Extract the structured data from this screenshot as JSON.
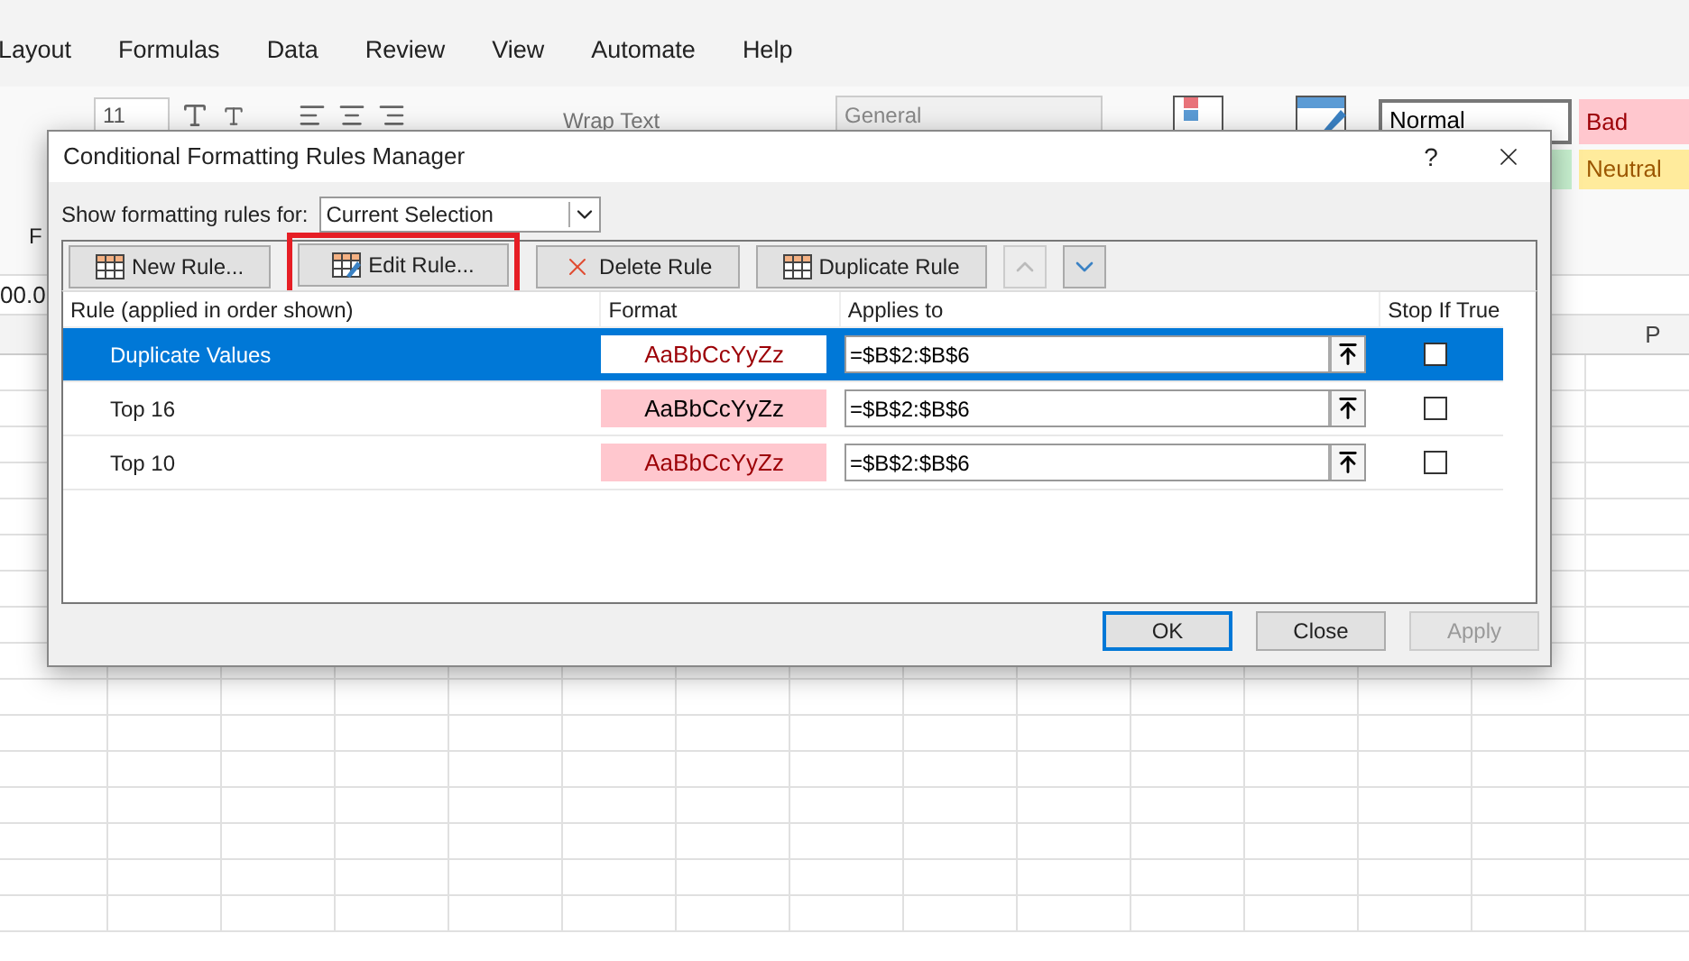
{
  "menu": [
    "Layout",
    "Formulas",
    "Data",
    "Review",
    "View",
    "Automate",
    "Help"
  ],
  "ribbon": {
    "font_size": "11",
    "wrap_text": "Wrap Text",
    "number_format": "General",
    "left_cut_1": "F",
    "left_cut_2": "00.0",
    "styles": [
      {
        "label": "Normal",
        "kind": "normal",
        "color": "#ffffff"
      },
      {
        "label": "Bad",
        "kind": "bad",
        "color": "#ffc7ce"
      },
      {
        "label": "Neutral",
        "kind": "neutral",
        "color": "#ffeb9c"
      }
    ]
  },
  "sheet": {
    "column_header": "P"
  },
  "dialog": {
    "title": "Conditional Formatting Rules Manager",
    "help": "?",
    "filter_label": "Show formatting rules for:",
    "filter_value": "Current Selection",
    "toolbar": [
      {
        "kind": "new",
        "label": "New Rule...",
        "disabled": false,
        "highlighted": false
      },
      {
        "kind": "edit",
        "label": "Edit Rule...",
        "disabled": false,
        "highlighted": true
      },
      {
        "kind": "delete",
        "label": "Delete Rule",
        "disabled": false,
        "highlighted": false
      },
      {
        "kind": "duplicate",
        "label": "Duplicate Rule",
        "disabled": false,
        "highlighted": false
      },
      {
        "kind": "up",
        "disabled": true,
        "highlighted": false
      },
      {
        "kind": "down",
        "disabled": false,
        "highlighted": false
      }
    ],
    "columns": [
      "Rule (applied in order shown)",
      "Format",
      "Applies to",
      "Stop If True"
    ],
    "rules": [
      {
        "name": "Duplicate Values",
        "sample": "AaBbCcYyZz",
        "kind": "plain",
        "color": "#9c0006",
        "applies_to": "=$B$2:$B$6",
        "stop_if_true": false,
        "selected": true
      },
      {
        "name": "Top 16",
        "sample": "AaBbCcYyZz",
        "kind": "filled",
        "color": "#000000",
        "applies_to": "=$B$2:$B$6",
        "stop_if_true": false,
        "selected": false
      },
      {
        "name": "Top 10",
        "sample": "AaBbCcYyZz",
        "kind": "filled",
        "color": "#9c0006",
        "applies_to": "=$B$2:$B$6",
        "stop_if_true": false,
        "selected": false
      }
    ],
    "buttons": [
      {
        "label": "OK",
        "default": true,
        "disabled": false
      },
      {
        "label": "Close",
        "default": false,
        "disabled": false
      },
      {
        "label": "Apply",
        "default": false,
        "disabled": true
      }
    ]
  }
}
